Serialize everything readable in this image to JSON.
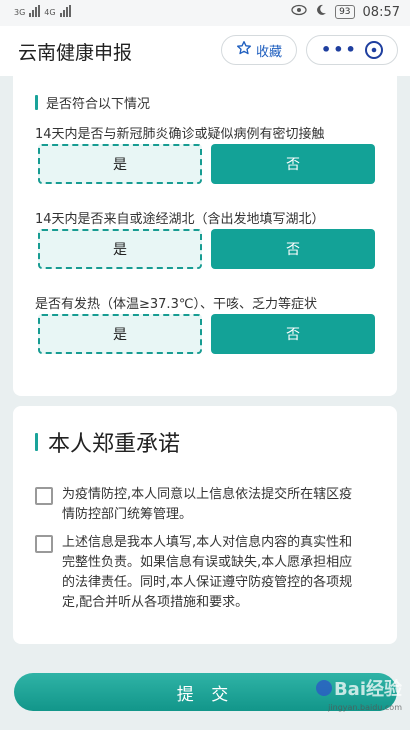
{
  "status_bar": {
    "signal_1": "3G",
    "signal_2": "4G",
    "battery": "93",
    "time": "08:57"
  },
  "header": {
    "title": "云南健康申报",
    "favorite_label": "收藏",
    "more_label": "•••"
  },
  "conditions": {
    "heading": "是否符合以下情况",
    "questions": [
      {
        "text": "14天内是否与新冠肺炎确诊或疑似病例有密切接触",
        "yes": "是",
        "no": "否"
      },
      {
        "text": "14天内是否来自或途经湖北（含出发地填写湖北）",
        "yes": "是",
        "no": "否"
      },
      {
        "text": "是否有发热（体温≥37.3℃）、干咳、乏力等症状",
        "yes": "是",
        "no": "否"
      }
    ],
    "selected_color": "#13a297"
  },
  "pledge": {
    "heading": "本人郑重承诺",
    "items": [
      {
        "text": "为疫情防控,本人同意以上信息依法提交所在辖区疫情防控部门统筹管理。",
        "checked": false
      },
      {
        "text": "上述信息是我本人填写,本人对信息内容的真实性和完整性负责。如果信息有误或缺失,本人愿承担相应的法律责任。同时,本人保证遵守防疫管控的各项规定,配合并听从各项措施和要求。",
        "checked": false
      }
    ]
  },
  "submit_label": "提 交",
  "watermark": {
    "logo": "Bai经验",
    "sub": "jingyan.baidu.com"
  }
}
